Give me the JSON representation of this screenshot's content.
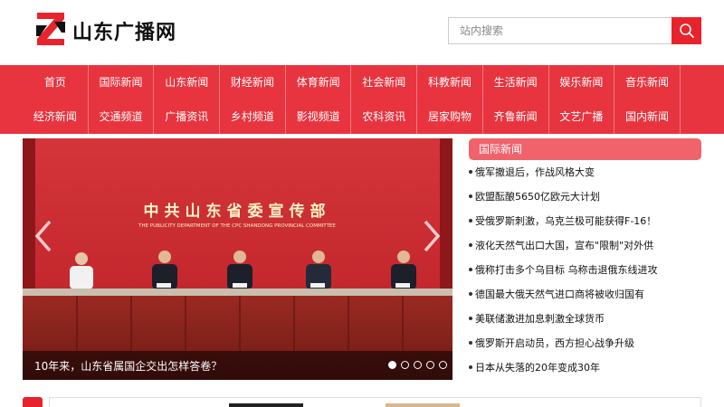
{
  "header": {
    "logo_text": "山东广播网",
    "search": {
      "placeholder": "站内搜索"
    }
  },
  "nav": {
    "row1": [
      "首页",
      "国际新闻",
      "山东新闻",
      "财经新闻",
      "体育新闻",
      "社会新闻",
      "科教新闻",
      "生活新闻",
      "娱乐新闻",
      "音乐新闻"
    ],
    "row2": [
      "经济新闻",
      "交通频道",
      "广播资讯",
      "乡村频道",
      "影视频道",
      "农科资讯",
      "居家购物",
      "齐鲁新闻",
      "文艺广播",
      "国内新闻"
    ]
  },
  "banner": {
    "backdrop_title": "中共山东省委宣传部",
    "backdrop_subtitle": "THE PUBLICITY DEPARTMENT OF THE CPC SHANDONG PROVINCIAL COMMITTEE",
    "caption": "10年来，山东省属国企交出怎样答卷？",
    "slide_count": 5,
    "active_slide": 1
  },
  "news": {
    "title": "国际新闻",
    "items": [
      "俄军撤退后，作战风格大变",
      "欧盟酝酿5650亿欧元大计划",
      "受俄罗斯刺激，乌克兰极可能获得F-16！",
      "液化天然气出口大国，宣布\"限制\"对外供",
      "俄称打击多个乌目标 乌称击退俄东线进攻",
      "德国最大俄天然气进口商将被收归国有",
      "美联储激进加息刺激全球货币",
      "俄罗斯开启动员，西方担心战争升级",
      "日本从失落的20年变成30年"
    ]
  },
  "colors": {
    "brand_red": "#e8232c",
    "nav_red": "#e8343f",
    "news_header": "#f0636b"
  }
}
